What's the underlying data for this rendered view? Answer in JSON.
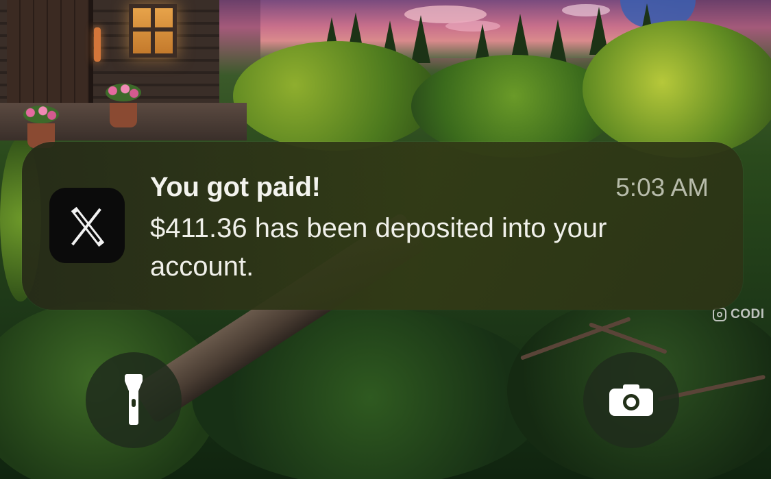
{
  "notification": {
    "app_icon": "x-logo-icon",
    "title": "You got paid!",
    "time": "5:03 AM",
    "body": "$411.36 has been deposited into your account."
  },
  "lockscreen": {
    "left_button_icon": "flashlight-icon",
    "right_button_icon": "camera-icon"
  },
  "watermark": {
    "icon": "instagram-icon",
    "text": "CODI"
  },
  "colors": {
    "notification_bg": "#2f3a18",
    "text_primary": "#f3f3ee",
    "text_secondary": "#c9cbbd",
    "button_bg": "#202c1c"
  }
}
